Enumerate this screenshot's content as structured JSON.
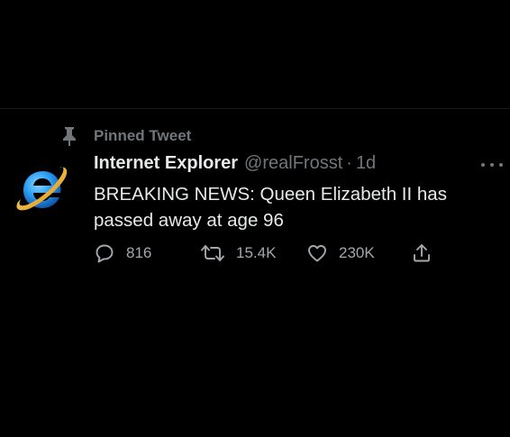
{
  "pinned": {
    "label": "Pinned Tweet",
    "icon": "pin-icon"
  },
  "author": {
    "display_name": "Internet Explorer",
    "handle": "@realFrosst",
    "separator": "·",
    "timestamp": "1d",
    "avatar_icon": "internet-explorer-logo-icon"
  },
  "tweet": {
    "text": "BREAKING NEWS: Queen Elizabeth II has passed away at age 96"
  },
  "actions": {
    "reply_count": "816",
    "retweet_count": "15.4K",
    "like_count": "230K"
  },
  "colors": {
    "background": "#000000",
    "primary_text": "#e7e9ea",
    "secondary_text": "#71767b",
    "ie_blue": "#1e88e5",
    "ie_gold": "#f2b01e"
  }
}
